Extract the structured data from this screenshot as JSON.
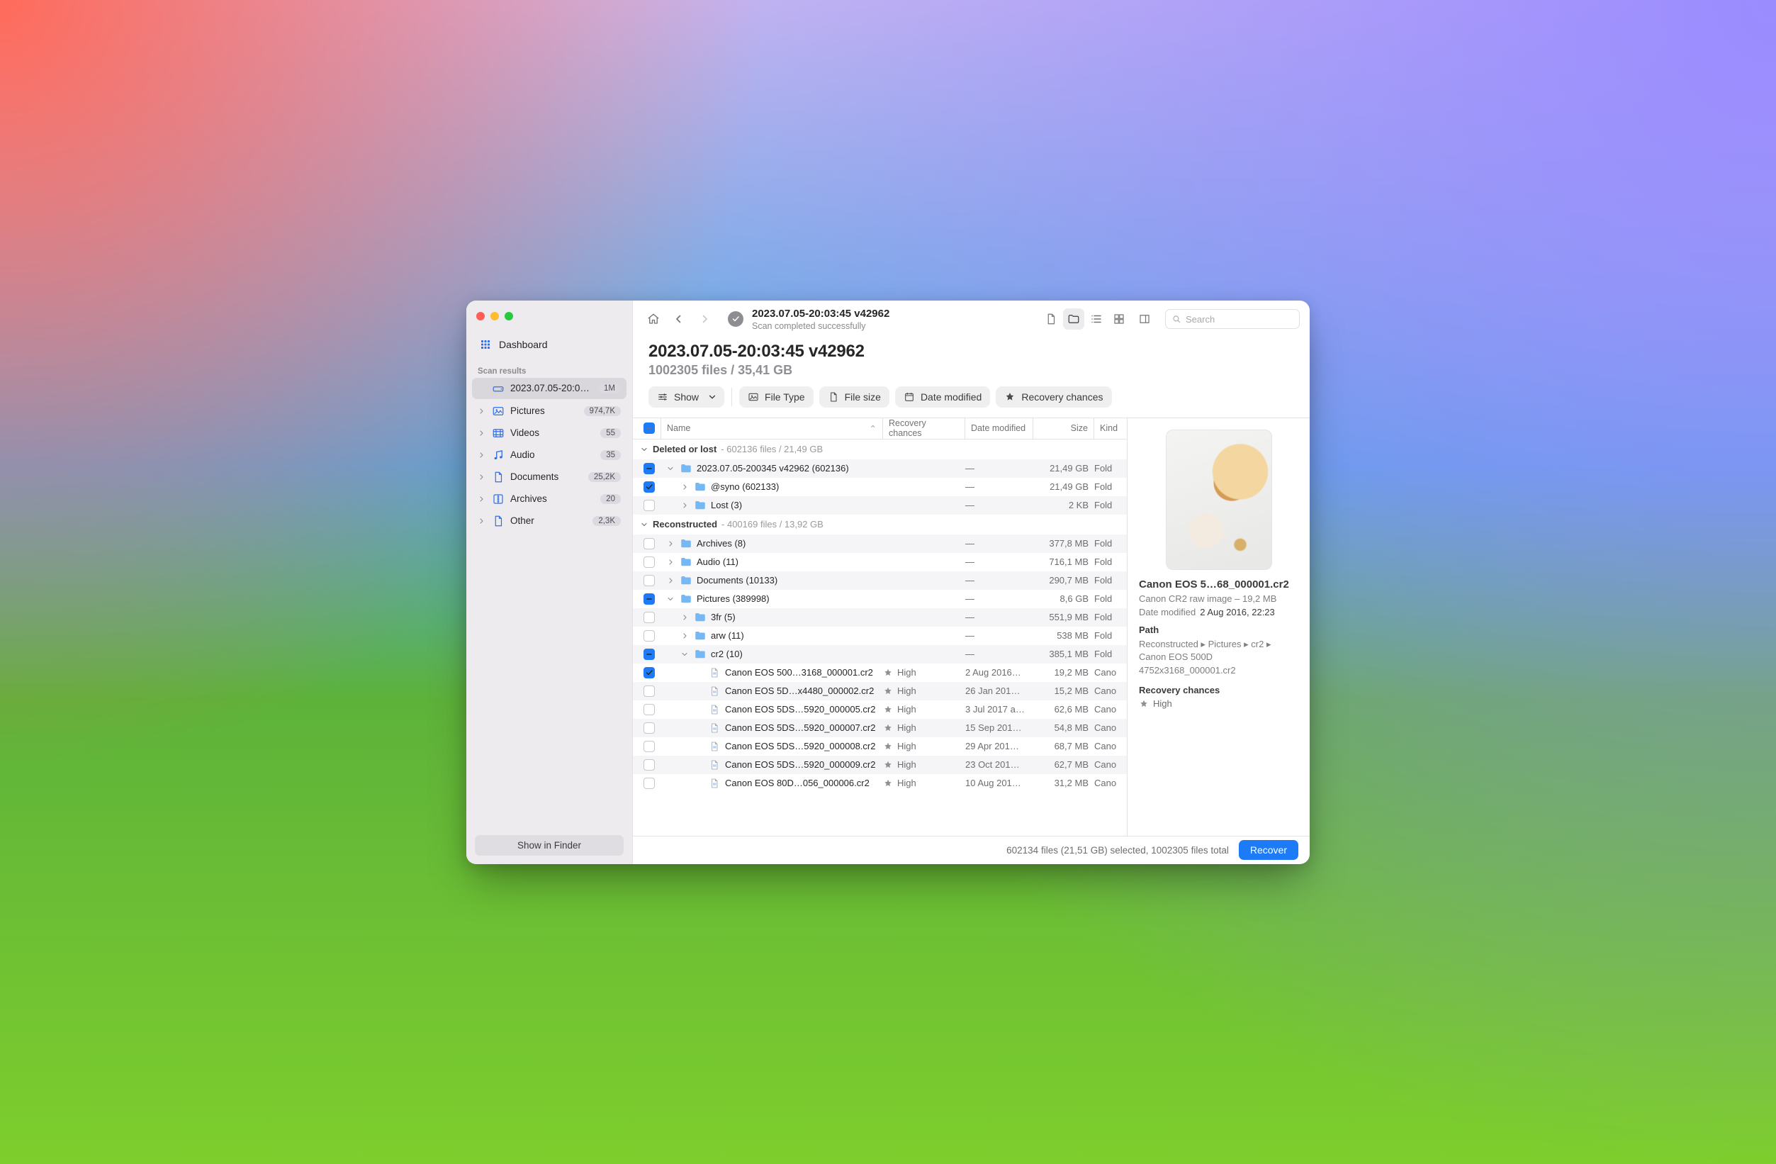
{
  "sidebar": {
    "dashboard_label": "Dashboard",
    "section_label": "Scan results",
    "scan_item": {
      "label": "2023.07.05-20:03:…",
      "badge": "1M"
    },
    "categories": [
      {
        "name": "Pictures",
        "badge": "974,7K"
      },
      {
        "name": "Videos",
        "badge": "55"
      },
      {
        "name": "Audio",
        "badge": "35"
      },
      {
        "name": "Documents",
        "badge": "25,2K"
      },
      {
        "name": "Archives",
        "badge": "20"
      },
      {
        "name": "Other",
        "badge": "2,3K"
      }
    ],
    "show_in_finder": "Show in Finder"
  },
  "toolbar": {
    "title": "2023.07.05-20:03:45 v42962",
    "subtitle": "Scan completed successfully",
    "search_placeholder": "Search"
  },
  "header": {
    "title": "2023.07.05-20:03:45 v42962",
    "subtitle": "1002305 files / 35,41 GB"
  },
  "filters": {
    "show": "Show",
    "file_type": "File Type",
    "file_size": "File size",
    "date_modified": "Date modified",
    "recovery_chances": "Recovery chances"
  },
  "columns": {
    "name": "Name",
    "recovery": "Recovery chances",
    "date": "Date modified",
    "size": "Size",
    "kind": "Kind"
  },
  "sections": {
    "deleted": {
      "label": "Deleted or lost",
      "meta": "602136 files / 21,49 GB"
    },
    "reconstructed": {
      "label": "Reconstructed",
      "meta": "400169 files / 13,92 GB"
    }
  },
  "rows": [
    {
      "section": "deleted",
      "indent": 0,
      "ck": "mixed",
      "disc": "down",
      "icon": "folder",
      "name": "2023.07.05-200345 v42962 (602136)",
      "rec": "",
      "date": "—",
      "size": "21,49 GB",
      "kind": "Folder"
    },
    {
      "section": "deleted",
      "indent": 1,
      "ck": "on",
      "disc": "right",
      "icon": "folder",
      "name": "@syno (602133)",
      "rec": "",
      "date": "—",
      "size": "21,49 GB",
      "kind": "Folder"
    },
    {
      "section": "deleted",
      "indent": 1,
      "ck": "off",
      "disc": "right",
      "icon": "folder",
      "name": "Lost (3)",
      "rec": "",
      "date": "—",
      "size": "2 KB",
      "kind": "Folder"
    },
    {
      "section": "reconstructed",
      "indent": 0,
      "ck": "off",
      "disc": "right",
      "icon": "folder",
      "name": "Archives (8)",
      "rec": "",
      "date": "—",
      "size": "377,8 MB",
      "kind": "Folder"
    },
    {
      "section": "reconstructed",
      "indent": 0,
      "ck": "off",
      "disc": "right",
      "icon": "folder",
      "name": "Audio (11)",
      "rec": "",
      "date": "—",
      "size": "716,1 MB",
      "kind": "Folder"
    },
    {
      "section": "reconstructed",
      "indent": 0,
      "ck": "off",
      "disc": "right",
      "icon": "folder",
      "name": "Documents (10133)",
      "rec": "",
      "date": "—",
      "size": "290,7 MB",
      "kind": "Folder"
    },
    {
      "section": "reconstructed",
      "indent": 0,
      "ck": "mixed",
      "disc": "down",
      "icon": "folder",
      "name": "Pictures (389998)",
      "rec": "",
      "date": "—",
      "size": "8,6 GB",
      "kind": "Folder"
    },
    {
      "section": "reconstructed",
      "indent": 1,
      "ck": "off",
      "disc": "right",
      "icon": "folder",
      "name": "3fr (5)",
      "rec": "",
      "date": "—",
      "size": "551,9 MB",
      "kind": "Folder"
    },
    {
      "section": "reconstructed",
      "indent": 1,
      "ck": "off",
      "disc": "right",
      "icon": "folder",
      "name": "arw (11)",
      "rec": "",
      "date": "—",
      "size": "538 MB",
      "kind": "Folder"
    },
    {
      "section": "reconstructed",
      "indent": 1,
      "ck": "mixed",
      "disc": "down",
      "icon": "folder",
      "name": "cr2 (10)",
      "rec": "",
      "date": "—",
      "size": "385,1 MB",
      "kind": "Folder"
    },
    {
      "section": "reconstructed",
      "indent": 2,
      "ck": "on",
      "disc": "none",
      "icon": "file",
      "name": "Canon EOS 500…3168_000001.cr2",
      "rec": "High",
      "date": "2 Aug 2016…",
      "size": "19,2 MB",
      "kind": "Canon…"
    },
    {
      "section": "reconstructed",
      "indent": 2,
      "ck": "off",
      "disc": "none",
      "icon": "file",
      "name": "Canon EOS 5D…x4480_000002.cr2",
      "rec": "High",
      "date": "26 Jan 201…",
      "size": "15,2 MB",
      "kind": "Canon…"
    },
    {
      "section": "reconstructed",
      "indent": 2,
      "ck": "off",
      "disc": "none",
      "icon": "file",
      "name": "Canon EOS 5DS…5920_000005.cr2",
      "rec": "High",
      "date": "3 Jul 2017 a…",
      "size": "62,6 MB",
      "kind": "Canon…"
    },
    {
      "section": "reconstructed",
      "indent": 2,
      "ck": "off",
      "disc": "none",
      "icon": "file",
      "name": "Canon EOS 5DS…5920_000007.cr2",
      "rec": "High",
      "date": "15 Sep 201…",
      "size": "54,8 MB",
      "kind": "Canon…"
    },
    {
      "section": "reconstructed",
      "indent": 2,
      "ck": "off",
      "disc": "none",
      "icon": "file",
      "name": "Canon EOS 5DS…5920_000008.cr2",
      "rec": "High",
      "date": "29 Apr 201…",
      "size": "68,7 MB",
      "kind": "Canon…"
    },
    {
      "section": "reconstructed",
      "indent": 2,
      "ck": "off",
      "disc": "none",
      "icon": "file",
      "name": "Canon EOS 5DS…5920_000009.cr2",
      "rec": "High",
      "date": "23 Oct 201…",
      "size": "62,7 MB",
      "kind": "Canon…"
    },
    {
      "section": "reconstructed",
      "indent": 2,
      "ck": "off",
      "disc": "none",
      "icon": "file",
      "name": "Canon EOS 80D…056_000006.cr2",
      "rec": "High",
      "date": "10 Aug 201…",
      "size": "31,2 MB",
      "kind": "Canon…"
    }
  ],
  "inspector": {
    "title": "Canon EOS 5…68_000001.cr2",
    "subtitle": "Canon CR2 raw image – 19,2 MB",
    "date_key": "Date modified",
    "date_val": "2 Aug 2016, 22:23",
    "path_label": "Path",
    "path_val": "Reconstructed ▸ Pictures ▸ cr2 ▸ Canon EOS 500D 4752x3168_000001.cr2",
    "rec_label": "Recovery chances",
    "rec_val": "High"
  },
  "status": {
    "summary": "602134 files (21,51 GB) selected, 1002305 files total",
    "recover_label": "Recover"
  }
}
